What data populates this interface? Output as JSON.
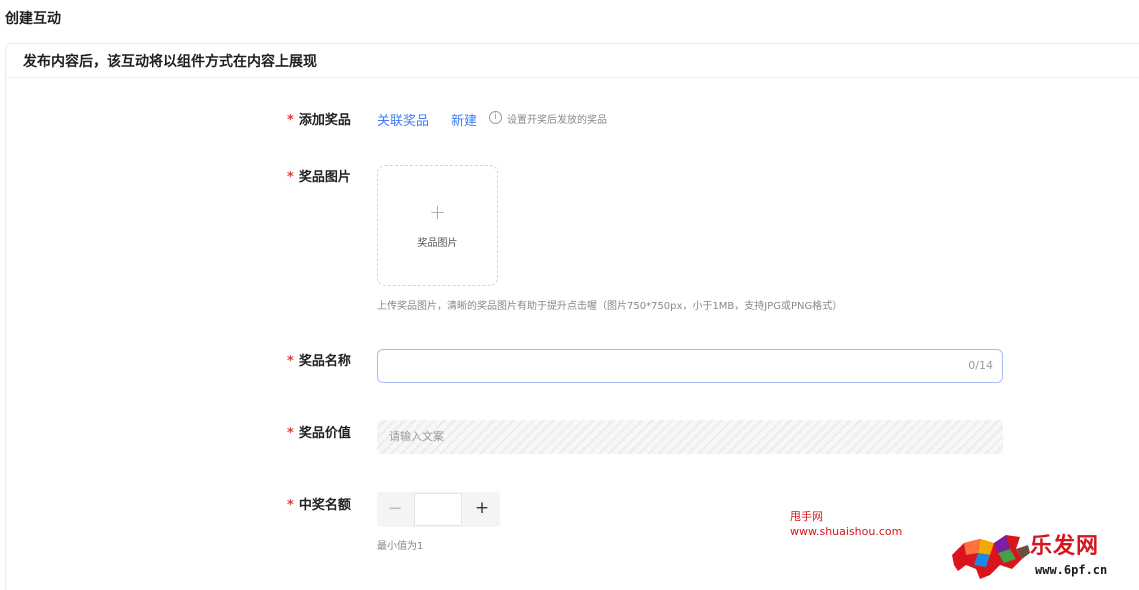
{
  "page": {
    "title": "创建互动"
  },
  "card": {
    "header": "发布内容后，该互动将以组件方式在内容上展现"
  },
  "form": {
    "required_mark": "*",
    "prize": {
      "label": "添加奖品",
      "link_related": "关联奖品",
      "link_new": "新建",
      "info_icon": "ⓘ",
      "hint": "设置开奖后发放的奖品"
    },
    "image": {
      "label": "奖品图片",
      "upload_plus": "+",
      "upload_text": "奖品图片",
      "tip": "上传奖品图片，清晰的奖品图片有助于提升点击喔（图片750*750px，小于1MB，支持JPG或PNG格式）"
    },
    "name": {
      "label": "奖品名称",
      "value": "",
      "count": "0/14"
    },
    "value": {
      "label": "奖品价值",
      "placeholder": "请输入文案"
    },
    "winners": {
      "label": "中奖名额",
      "minus": "−",
      "plus": "+",
      "value": "",
      "tip": "最小值为1"
    }
  },
  "watermark": {
    "line1": "甩手网",
    "line2": "www.shuaishou.com",
    "brand": "乐发网",
    "url": "www.6pf.cn"
  },
  "colors": {
    "accent": "#3d7cf5",
    "required": "#e23c39",
    "watermark": "#d8141c"
  }
}
